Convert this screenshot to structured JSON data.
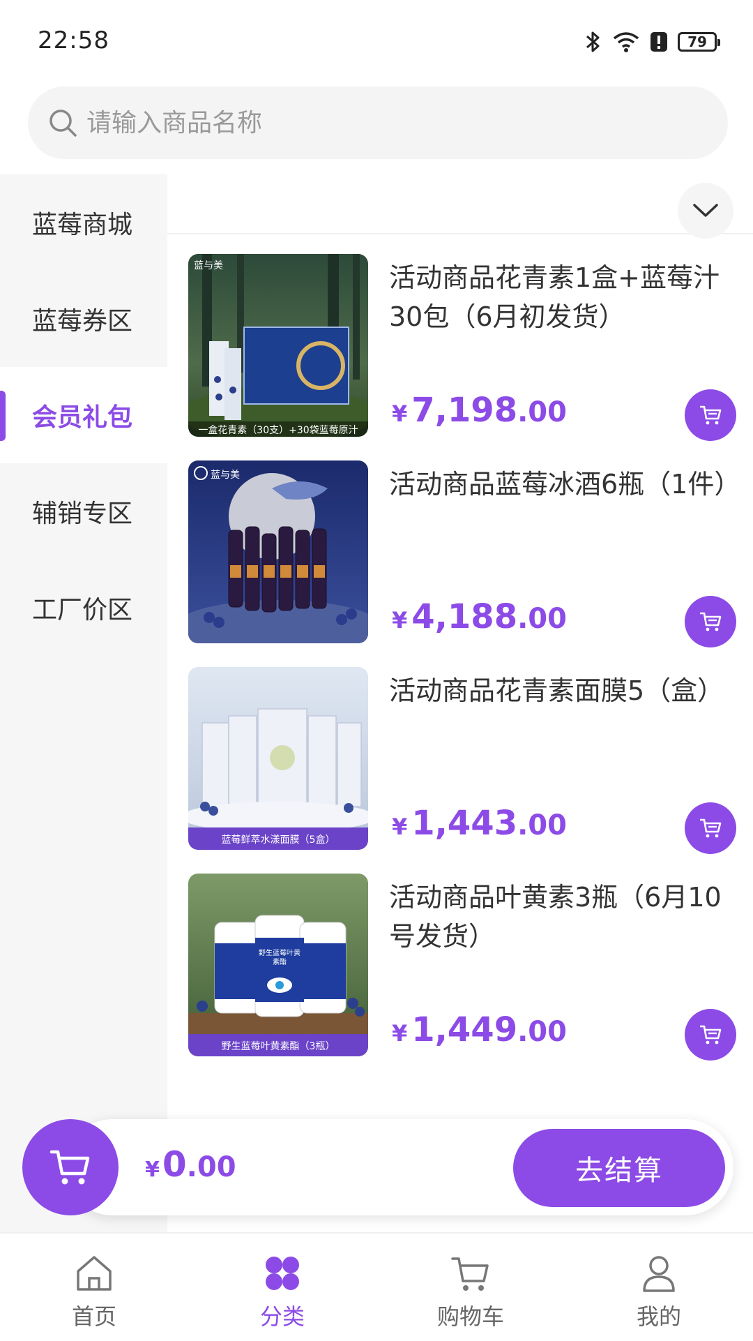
{
  "status_bar": {
    "time": "22:58",
    "battery": "79"
  },
  "search": {
    "placeholder": "请输入商品名称"
  },
  "sidebar": {
    "items": [
      {
        "label": "蓝莓商城"
      },
      {
        "label": "蓝莓券区"
      },
      {
        "label": "会员礼包"
      },
      {
        "label": "辅销专区"
      },
      {
        "label": "工厂价区"
      }
    ],
    "active_index": 2
  },
  "products": [
    {
      "title": "活动商品花青素1盒+蓝莓汁30包（6月初发货）",
      "currency": "¥",
      "price_int": "7,198",
      "price_dec": ".00",
      "image_caption": "一盒花青素（30支）+30袋蓝莓原汁",
      "image_brand": "蓝与美"
    },
    {
      "title": "活动商品蓝莓冰酒6瓶（1件）",
      "currency": "¥",
      "price_int": "4,188",
      "price_dec": ".00",
      "image_caption": "",
      "image_brand": "蓝与美"
    },
    {
      "title": "活动商品花青素面膜5（盒）",
      "currency": "¥",
      "price_int": "1,443",
      "price_dec": ".00",
      "image_caption": "蓝莓鲜萃水漾面膜（5盒）",
      "image_brand": ""
    },
    {
      "title": "活动商品叶黄素3瓶（6月10号发货）",
      "currency": "¥",
      "price_int": "1,449",
      "price_dec": ".00",
      "image_caption": "野生蓝莓叶黄素酯（3瓶）",
      "image_label": "野生蓝莓叶黄素酯"
    }
  ],
  "cart": {
    "currency": "¥",
    "total_int": "0",
    "total_dec": ".00",
    "checkout_label": "去结算"
  },
  "tabbar": {
    "items": [
      {
        "label": "首页",
        "icon": "home-icon"
      },
      {
        "label": "分类",
        "icon": "category-icon"
      },
      {
        "label": "购物车",
        "icon": "cart-icon"
      },
      {
        "label": "我的",
        "icon": "user-icon"
      }
    ],
    "active_index": 1
  },
  "colors": {
    "accent": "#8c4be6",
    "sidebar_bg": "#f6f6f7",
    "search_bg": "#f4f4f5"
  }
}
